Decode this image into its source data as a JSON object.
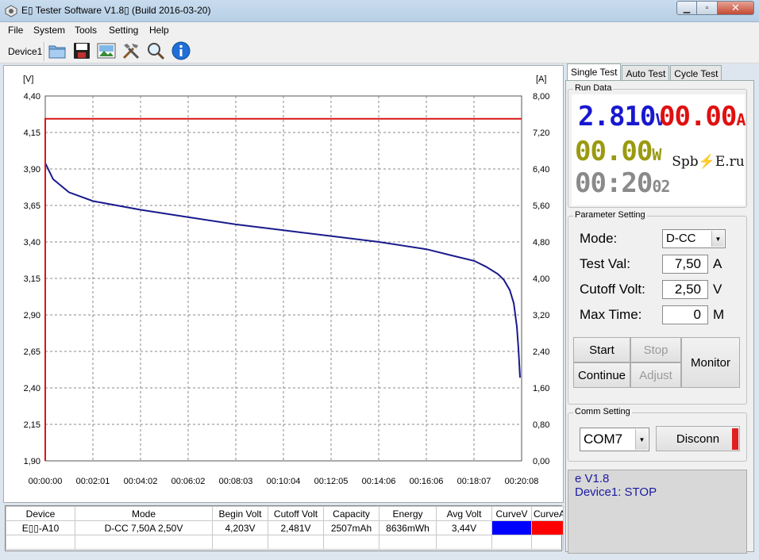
{
  "window": {
    "title": "E▯ Tester Software V1.8▯ (Build 2016-03-20)",
    "min_glyph": "▁",
    "max_glyph": "▫",
    "close_glyph": "✕"
  },
  "menu": [
    "File",
    "System",
    "Tools",
    "Setting",
    "Help"
  ],
  "toolbar": {
    "device": "Device1",
    "icons": [
      "folder-icon",
      "save-icon",
      "image-icon",
      "tools-icon",
      "search-icon",
      "info-icon"
    ]
  },
  "chart_data": {
    "type": "line",
    "y_left_unit": "[V]",
    "y_right_unit": "[A]",
    "y_left_ticks": [
      "4,40",
      "4,15",
      "3,90",
      "3,65",
      "3,40",
      "3,15",
      "2,90",
      "2,65",
      "2,40",
      "2,15",
      "1,90"
    ],
    "y_right_ticks": [
      "8,00",
      "7,20",
      "6,40",
      "5,60",
      "4,80",
      "4,00",
      "3,20",
      "2,40",
      "1,60",
      "0,80",
      "0,00"
    ],
    "x_ticks": [
      "00:00:00",
      "00:02:01",
      "00:04:02",
      "00:06:02",
      "00:08:03",
      "00:10:04",
      "00:12:05",
      "00:14:06",
      "00:16:06",
      "00:18:07",
      "00:20:08"
    ],
    "ylim_left": [
      1.9,
      4.4
    ],
    "ylim_right": [
      0,
      8
    ],
    "xlim_seconds": [
      0,
      1208
    ],
    "grid": true,
    "series": [
      {
        "axis": "left",
        "color": "#1a1a8c",
        "x_seconds": [
          0,
          20,
          60,
          121,
          242,
          362,
          483,
          604,
          725,
          846,
          967,
          1027,
          1088,
          1118,
          1148,
          1163,
          1178,
          1188,
          1196,
          1200,
          1204
        ],
        "values": [
          3.94,
          3.83,
          3.74,
          3.68,
          3.62,
          3.57,
          3.52,
          3.48,
          3.44,
          3.4,
          3.35,
          3.31,
          3.27,
          3.23,
          3.18,
          3.14,
          3.07,
          2.98,
          2.82,
          2.67,
          2.47
        ]
      },
      {
        "axis": "right",
        "color": "#d81818",
        "x_seconds": [
          0,
          0,
          1208
        ],
        "values": [
          0,
          7.5,
          7.5
        ]
      }
    ]
  },
  "table": {
    "headers": [
      "Device",
      "Mode",
      "Begin Volt",
      "Cutoff Volt",
      "Capacity",
      "Energy",
      "Avg Volt",
      "CurveV",
      "CurveA"
    ],
    "row": [
      "E▯▯-A10",
      "D-CC  7,50A  2,50V",
      "4,203V",
      "2,481V",
      "2507mAh",
      "8636mWh",
      "3,44V",
      "",
      ""
    ],
    "curve_colors": [
      "#0000ff",
      "#ff0000"
    ]
  },
  "tabs": [
    "Single Test",
    "Auto Test",
    "Cycle Test"
  ],
  "run_data": {
    "label": "Run Data",
    "voltage": "2.810",
    "voltage_unit": "V",
    "current": "00.00",
    "current_unit": "A",
    "power": "00.00",
    "power_unit": "W",
    "time": "00:20",
    "time_seconds": "02",
    "logo": "Spb⚡E.ru"
  },
  "params": {
    "label": "Parameter Setting",
    "mode_label": "Mode:",
    "mode_value": "D-CC",
    "test_val_label": "Test Val:",
    "test_val": "7,50",
    "test_val_unit": "A",
    "cutoff_label": "Cutoff Volt:",
    "cutoff_val": "2,50",
    "cutoff_unit": "V",
    "maxtime_label": "Max Time:",
    "maxtime_val": "0",
    "maxtime_unit": "M"
  },
  "buttons": {
    "start": "Start",
    "stop": "Stop",
    "continue": "Continue",
    "adjust": "Adjust",
    "monitor": "Monitor"
  },
  "comm": {
    "label": "Comm Setting",
    "port": "COM7",
    "disconnect": "Disconn"
  },
  "status": {
    "line1": "e V1.8",
    "line2": "Device1: STOP"
  }
}
